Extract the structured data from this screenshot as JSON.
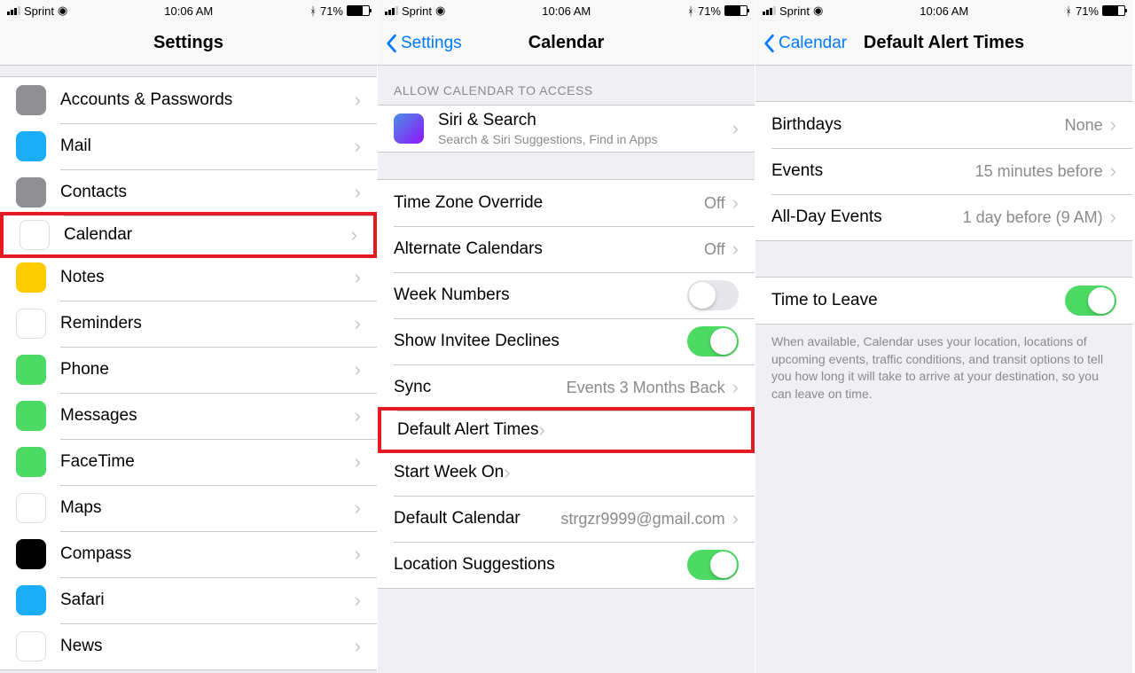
{
  "status": {
    "carrier": "Sprint",
    "time": "10:06 AM",
    "bt": "✵",
    "battery": "71%"
  },
  "screen1": {
    "title": "Settings",
    "items": [
      {
        "label": "Accounts & Passwords",
        "iconBg": "#8e8e93"
      },
      {
        "label": "Mail",
        "iconBg": "#1badf8"
      },
      {
        "label": "Contacts",
        "iconBg": "#8e8e93"
      },
      {
        "label": "Calendar",
        "iconBg": "#ffffff",
        "highlight": true
      },
      {
        "label": "Notes",
        "iconBg": "#ffcc00"
      },
      {
        "label": "Reminders",
        "iconBg": "#ffffff"
      },
      {
        "label": "Phone",
        "iconBg": "#4cd964"
      },
      {
        "label": "Messages",
        "iconBg": "#4cd964"
      },
      {
        "label": "FaceTime",
        "iconBg": "#4cd964"
      },
      {
        "label": "Maps",
        "iconBg": "#ffffff"
      },
      {
        "label": "Compass",
        "iconBg": "#000000"
      },
      {
        "label": "Safari",
        "iconBg": "#1badf8"
      },
      {
        "label": "News",
        "iconBg": "#ffffff"
      }
    ]
  },
  "screen2": {
    "back": "Settings",
    "title": "Calendar",
    "allowHeader": "ALLOW CALENDAR TO ACCESS",
    "siri": {
      "label": "Siri & Search",
      "sub": "Search & Siri Suggestions, Find in Apps"
    },
    "rows": {
      "tz": {
        "label": "Time Zone Override",
        "value": "Off"
      },
      "alt": {
        "label": "Alternate Calendars",
        "value": "Off"
      },
      "wk": {
        "label": "Week Numbers"
      },
      "inv": {
        "label": "Show Invitee Declines"
      },
      "sync": {
        "label": "Sync",
        "value": "Events 3 Months Back"
      },
      "def": {
        "label": "Default Alert Times"
      },
      "start": {
        "label": "Start Week On"
      },
      "cal": {
        "label": "Default Calendar",
        "value": "strgzr9999@gmail.com"
      },
      "loc": {
        "label": "Location Suggestions"
      }
    }
  },
  "screen3": {
    "back": "Calendar",
    "title": "Default Alert Times",
    "rows": {
      "bday": {
        "label": "Birthdays",
        "value": "None"
      },
      "events": {
        "label": "Events",
        "value": "15 minutes before"
      },
      "allday": {
        "label": "All-Day Events",
        "value": "1 day before (9 AM)"
      }
    },
    "ttl": {
      "label": "Time to Leave"
    },
    "footer": "When available, Calendar uses your location, locations of upcoming events, traffic conditions, and transit options to tell you how long it will take to arrive at your destination, so you can leave on time."
  }
}
